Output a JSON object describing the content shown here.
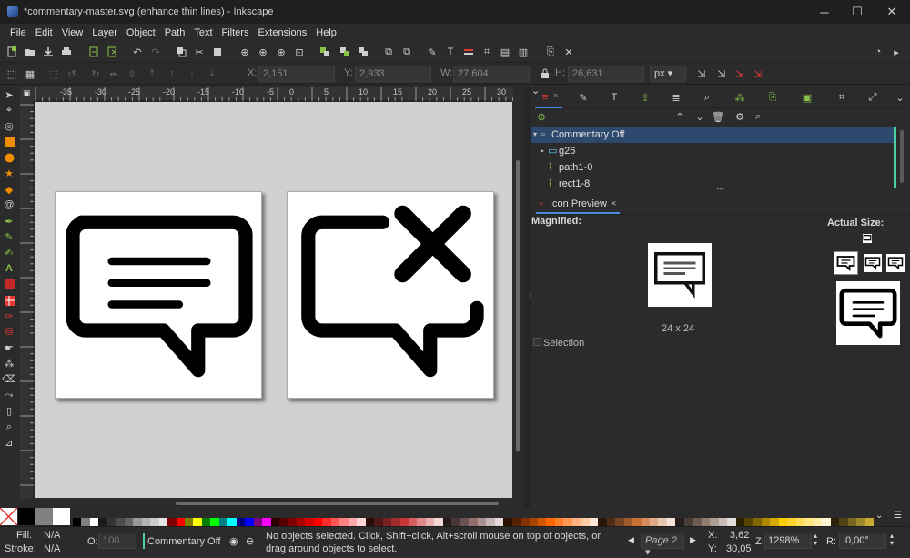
{
  "window": {
    "title": "*commentary-master.svg (enhance thin lines) - Inkscape",
    "minimize": "─",
    "maximize": "☐",
    "close": "✕"
  },
  "menu": [
    "File",
    "Edit",
    "View",
    "Layer",
    "Object",
    "Path",
    "Text",
    "Filters",
    "Extensions",
    "Help"
  ],
  "controls": {
    "x_label": "X:",
    "x_value": "2,151",
    "y_label": "Y:",
    "y_value": "2,933",
    "w_label": "W:",
    "w_value": "27,604",
    "h_label": "H:",
    "h_value": "26,631",
    "unit": "px"
  },
  "ruler": {
    "h_labels": [
      "-35",
      "-30",
      "-25",
      "-20",
      "-15",
      "-10",
      "-5",
      "0",
      "5",
      "10",
      "15",
      "20",
      "25",
      "30"
    ]
  },
  "objects": {
    "rows": [
      {
        "label": "Commentary Off",
        "selected": true
      },
      {
        "label": "g26",
        "selected": false
      },
      {
        "label": "path1-0",
        "selected": false
      },
      {
        "label": "rect1-8",
        "selected": false
      }
    ]
  },
  "icon_preview": {
    "tab_label": "Icon Preview",
    "tab_close": "×",
    "magnified_label": "Magnified:",
    "size_label": "24 x 24",
    "selection_label": "Selection",
    "actual_size_label": "Actual Size:"
  },
  "palette": {
    "colors": [
      "#000000",
      "#808080",
      "#ffffff",
      "#1a1a1a",
      "#333333",
      "#4d4d4d",
      "#666666",
      "#999999",
      "#b3b3b3",
      "#cccccc",
      "#e6e6e6",
      "#800000",
      "#ff0000",
      "#808000",
      "#ffff00",
      "#008000",
      "#00ff00",
      "#008080",
      "#00ffff",
      "#000080",
      "#0000ff",
      "#800080",
      "#ff00ff",
      "#2b0000",
      "#550000",
      "#800000",
      "#aa0000",
      "#d40000",
      "#ff0000",
      "#ff2a2a",
      "#ff5555",
      "#ff8080",
      "#ffaaaa",
      "#ffd5d5",
      "#280b0b",
      "#501616",
      "#782121",
      "#a02c2c",
      "#c83737",
      "#d35f5f",
      "#de8787",
      "#e9afaf",
      "#f4d7d7",
      "#241c1c",
      "#483737",
      "#6c5353",
      "#916f6f",
      "#ac9393",
      "#c8b7b7",
      "#e3dbdb",
      "#2b1100",
      "#552200",
      "#803300",
      "#aa4400",
      "#d45500",
      "#ff6600",
      "#ff7f2a",
      "#ff9955",
      "#ffb380",
      "#ffccaa",
      "#ffe6d5",
      "#28170b",
      "#502d16",
      "#784421",
      "#a05a2c",
      "#c87137",
      "#d38d5f",
      "#deaa87",
      "#e9c6af",
      "#f4e3d7",
      "#241f1c",
      "#483e37",
      "#6c5d53",
      "#917c6f",
      "#ac9d93",
      "#c8beb7",
      "#e3dedb",
      "#2b2200",
      "#554400",
      "#806600",
      "#aa8800",
      "#d4aa00",
      "#ffcc00",
      "#ffd42a",
      "#ffdd55",
      "#ffe680",
      "#ffeeaa",
      "#fff6d5",
      "#28220b",
      "#504416",
      "#786721",
      "#a0892c",
      "#c8ab37"
    ],
    "none_label": "none"
  },
  "status": {
    "fill_label": "Fill:",
    "fill_value": "N/A",
    "stroke_label": "Stroke:",
    "stroke_value": "N/A",
    "opacity_label": "O:",
    "opacity_value": "100",
    "layer_name": "Commentary Off",
    "message": "No objects selected. Click, Shift+click, Alt+scroll mouse on top of objects, or drag around objects to select.",
    "page_label": "Page 2",
    "x_label": "X:",
    "x_value": "3,62",
    "y_label": "Y:",
    "y_value": "30,05",
    "zoom_label": "Z:",
    "zoom_value": "1298%",
    "rotate_label": "R:",
    "rotate_value": "0,00°"
  }
}
